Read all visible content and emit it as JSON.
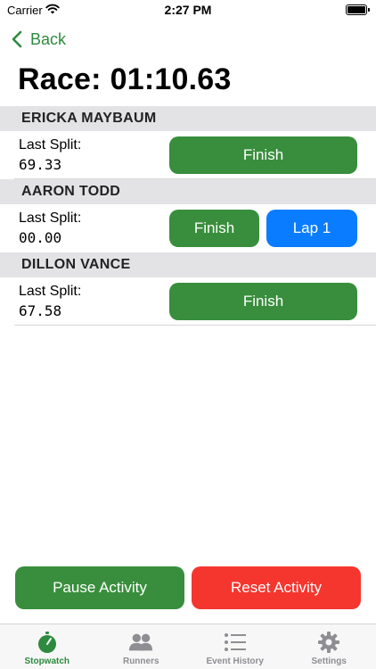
{
  "status_bar": {
    "carrier": "Carrier",
    "time": "2:27 PM"
  },
  "nav": {
    "back_label": "Back"
  },
  "race": {
    "label": "Race:",
    "time": "01:10.63"
  },
  "runners": [
    {
      "name": "ERICKA MAYBAUM",
      "split_label": "Last Split:",
      "split_value": "69.33",
      "finish_label": "Finish"
    },
    {
      "name": "AARON TODD",
      "split_label": "Last Split:",
      "split_value": "00.00",
      "finish_label": "Finish",
      "lap_label": "Lap 1"
    },
    {
      "name": "DILLON VANCE",
      "split_label": "Last Split:",
      "split_value": "67.58",
      "finish_label": "Finish"
    }
  ],
  "actions": {
    "pause_label": "Pause Activity",
    "reset_label": "Reset Activity"
  },
  "tabs": [
    {
      "label": "Stopwatch",
      "icon": "stopwatch-icon",
      "active": true
    },
    {
      "label": "Runners",
      "icon": "people-icon",
      "active": false
    },
    {
      "label": "Event History",
      "icon": "list-icon",
      "active": false
    },
    {
      "label": "Settings",
      "icon": "gear-icon",
      "active": false
    }
  ],
  "colors": {
    "accent_green": "#388e3c",
    "lap_blue": "#0a7cff",
    "reset_red": "#f5362f",
    "header_gray": "#e3e3e6"
  }
}
